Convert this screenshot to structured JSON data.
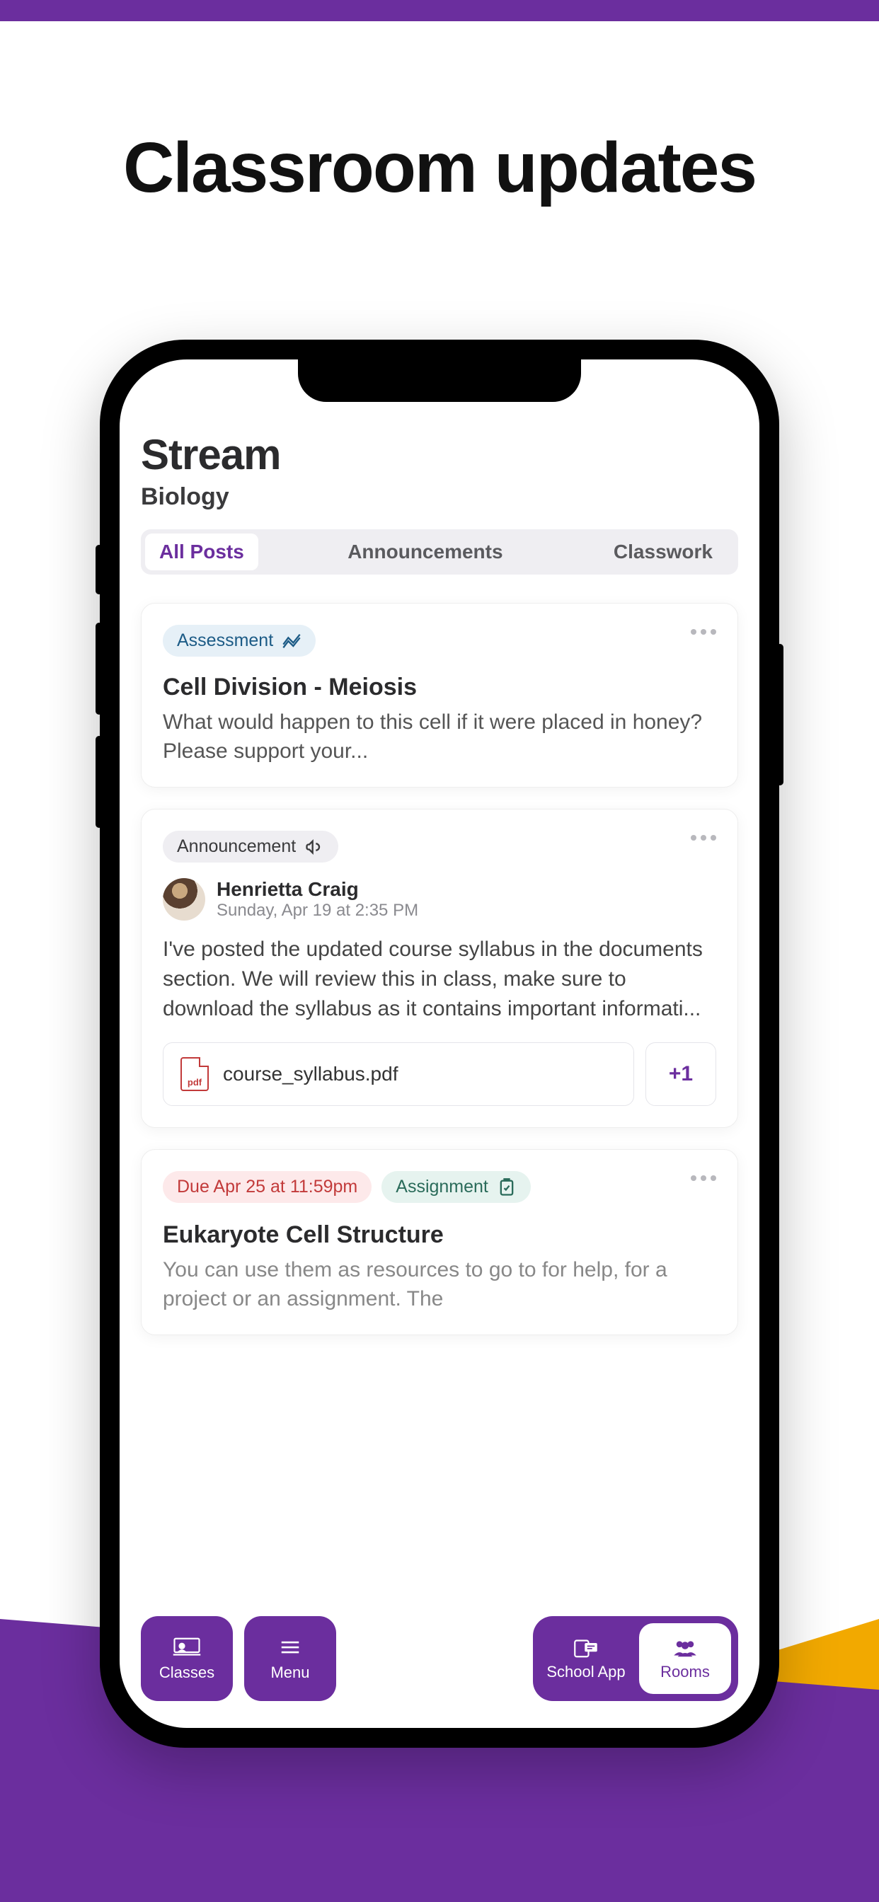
{
  "promo": {
    "title": "Classroom updates"
  },
  "header": {
    "title": "Stream",
    "subtitle": "Biology"
  },
  "tabs": [
    {
      "label": "All Posts",
      "active": true
    },
    {
      "label": "Announcements",
      "active": false
    },
    {
      "label": "Classwork",
      "active": false
    }
  ],
  "posts": {
    "assessment": {
      "tag": "Assessment",
      "title": "Cell Division - Meiosis",
      "body": "What would happen to this cell if it were placed in honey? Please support your..."
    },
    "announcement": {
      "tag": "Announcement",
      "author": "Henrietta Craig",
      "timestamp": "Sunday, Apr 19 at 2:35 PM",
      "body": "I've posted the updated course syllabus in the documents section. We will review this in class, make sure to download the syllabus as it contains important informati...",
      "attachment": {
        "icon_label": "pdf",
        "filename": "course_syllabus.pdf",
        "extra": "+1"
      }
    },
    "assignment": {
      "due": "Due Apr 25 at 11:59pm",
      "tag": "Assignment",
      "title": "Eukaryote Cell Structure",
      "body": "You can use them as resources to go to for help, for a project or an assignment. The"
    }
  },
  "nav": {
    "classes": "Classes",
    "menu": "Menu",
    "school_app": "School App",
    "rooms": "Rooms"
  }
}
